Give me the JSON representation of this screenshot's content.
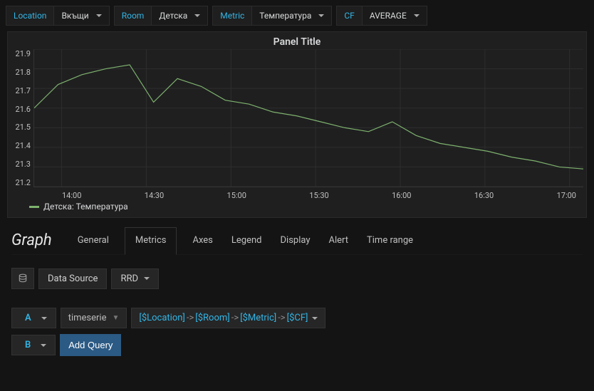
{
  "vars": {
    "location_label": "Location",
    "location_value": "Вкъщи",
    "room_label": "Room",
    "room_value": "Детска",
    "metric_label": "Metric",
    "metric_value": "Температура",
    "cf_label": "CF",
    "cf_value": "AVERAGE"
  },
  "panel": {
    "title": "Panel Title",
    "legend": "Детска: Температура"
  },
  "chart_data": {
    "type": "line",
    "title": "Panel Title",
    "ylabel": "",
    "xlabel": "",
    "ylim": [
      21.2,
      21.9
    ],
    "x_ticks": [
      "14:00",
      "14:30",
      "15:00",
      "15:30",
      "16:00",
      "16:30",
      "17:00"
    ],
    "y_ticks": [
      21.2,
      21.3,
      21.4,
      21.5,
      21.6,
      21.7,
      21.8,
      21.9
    ],
    "series": [
      {
        "name": "Детска: Температура",
        "color": "#7eb26d",
        "x": [
          "13:40",
          "13:50",
          "14:00",
          "14:10",
          "14:20",
          "14:30",
          "14:40",
          "14:50",
          "15:00",
          "15:10",
          "15:20",
          "15:30",
          "15:40",
          "15:50",
          "16:00",
          "16:10",
          "16:20",
          "16:30",
          "16:40",
          "16:50",
          "17:00",
          "17:10",
          "17:20",
          "17:25"
        ],
        "y": [
          21.6,
          21.72,
          21.77,
          21.8,
          21.82,
          21.63,
          21.75,
          21.71,
          21.64,
          21.62,
          21.58,
          21.56,
          21.53,
          21.5,
          21.48,
          21.53,
          21.46,
          21.42,
          21.4,
          21.38,
          21.35,
          21.33,
          21.3,
          21.29
        ]
      }
    ]
  },
  "editor": {
    "title": "Graph",
    "tabs": [
      "General",
      "Metrics",
      "Axes",
      "Legend",
      "Display",
      "Alert",
      "Time range"
    ],
    "active_tab": "Metrics",
    "datasource_label": "Data Source",
    "datasource_value": "RRD",
    "row_a": {
      "fn": "timeserie",
      "parts": [
        "[$Location]",
        "[$Room]",
        "[$Metric]",
        "[$CF]"
      ],
      "sep": "->"
    },
    "row_b": {
      "add_query": "Add Query"
    }
  }
}
